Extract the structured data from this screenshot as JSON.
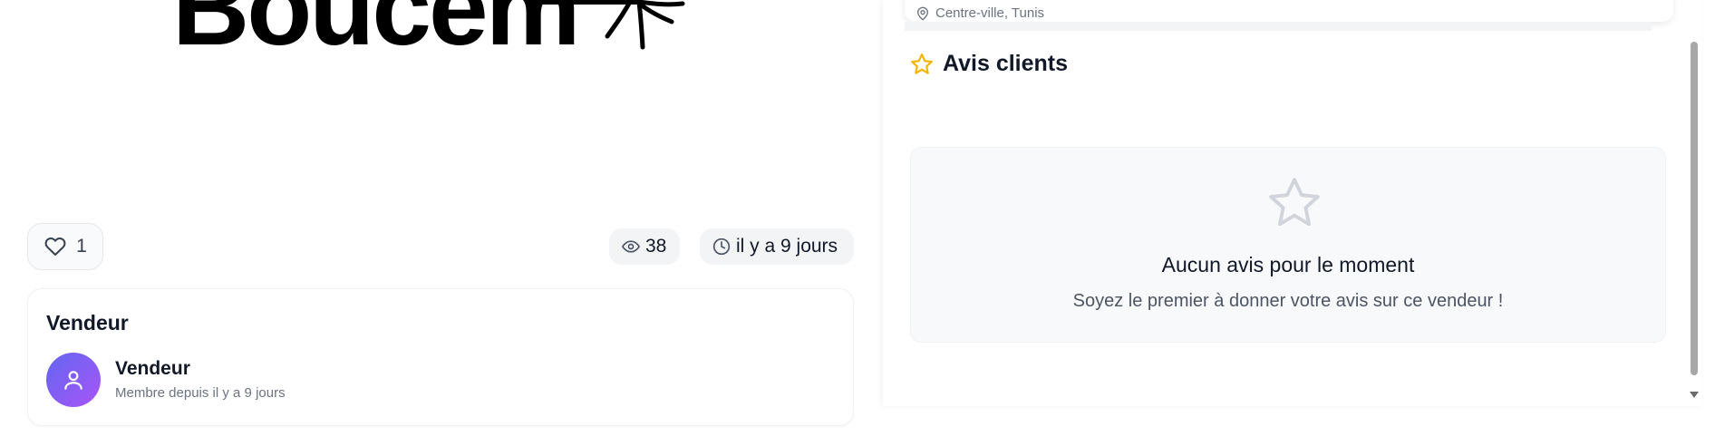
{
  "listing": {
    "logo_text": "Boucem",
    "likes": "1",
    "views": "38",
    "posted": "il y a 9 jours"
  },
  "seller_section": {
    "title": "Vendeur",
    "name": "Vendeur",
    "member_since": "Membre depuis il y a 9 jours"
  },
  "location": {
    "text": "Centre-ville, Tunis"
  },
  "reviews": {
    "title": "Avis clients",
    "empty_title": "Aucun avis pour le moment",
    "empty_subtitle": "Soyez le premier à donner votre avis sur ce vendeur !"
  },
  "colors": {
    "accent_star": "#f5b400",
    "avatar_gradient_start": "#6366f1",
    "avatar_gradient_end": "#a855f7"
  },
  "icons": {
    "like": "heart-icon",
    "views": "eye-icon",
    "time": "clock-icon",
    "location": "map-pin-icon",
    "reviews": "star-icon",
    "avatar": "user-icon"
  }
}
